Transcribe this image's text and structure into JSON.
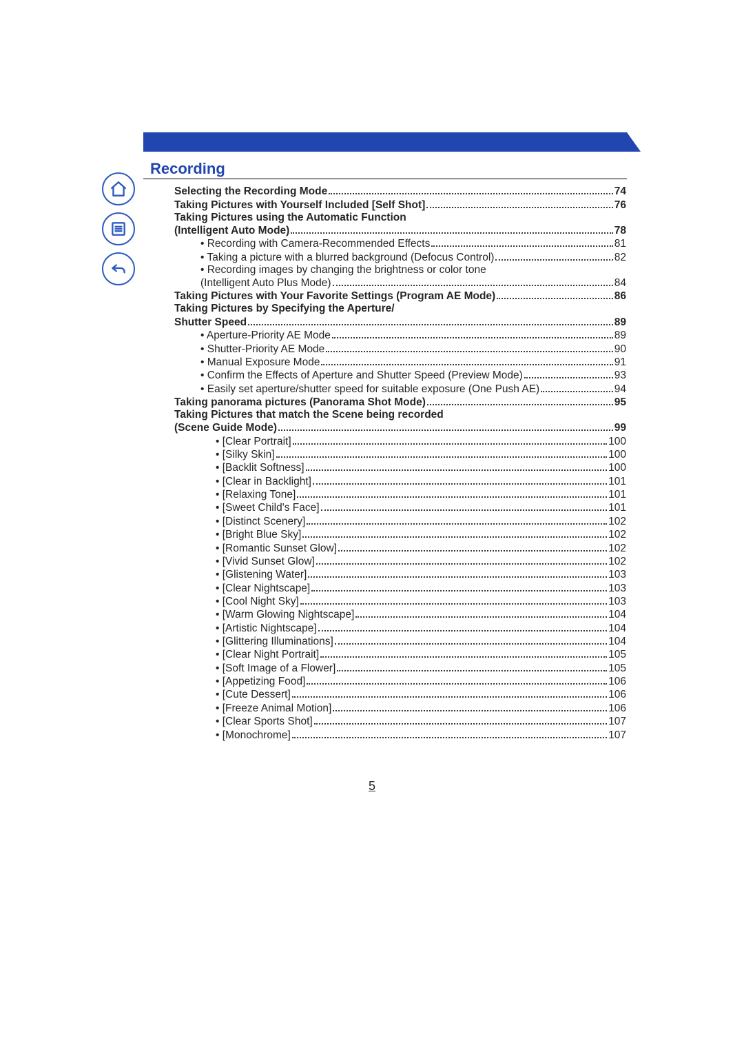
{
  "pageNumber": "5",
  "sectionTitle": "Recording",
  "sidebar": {
    "home": "home-icon",
    "toc": "toc-icon",
    "back": "back-icon"
  },
  "entries": [
    {
      "level": 1,
      "bold": true,
      "bullet": false,
      "text": "Selecting the Recording Mode",
      "page": "74"
    },
    {
      "level": 1,
      "bold": true,
      "bullet": false,
      "text": "Taking Pictures with Yourself Included [Self Shot]",
      "page": "76"
    },
    {
      "level": 1,
      "bold": true,
      "bullet": false,
      "text": "Taking Pictures using the Automatic Function",
      "page": "",
      "noLeader": true
    },
    {
      "level": 1,
      "bold": true,
      "bullet": false,
      "text": "(Intelligent Auto Mode)",
      "page": "78"
    },
    {
      "level": 2,
      "bold": false,
      "bullet": true,
      "text": "Recording with Camera-Recommended Effects",
      "page": "81"
    },
    {
      "level": 2,
      "bold": false,
      "bullet": true,
      "text": "Taking a picture with a blurred background (Defocus Control)",
      "page": "82"
    },
    {
      "level": 2,
      "bold": false,
      "bullet": true,
      "text": "Recording images by changing the brightness or color tone",
      "page": "",
      "noLeader": true
    },
    {
      "level": 2,
      "bold": false,
      "bullet": false,
      "text": "(Intelligent Auto Plus Mode)",
      "page": "84"
    },
    {
      "level": 1,
      "bold": true,
      "bullet": false,
      "text": "Taking Pictures with Your Favorite Settings (Program AE Mode)",
      "page": "86"
    },
    {
      "level": 1,
      "bold": true,
      "bullet": false,
      "text": "Taking Pictures by Specifying the Aperture/",
      "page": "",
      "noLeader": true
    },
    {
      "level": 1,
      "bold": true,
      "bullet": false,
      "text": "Shutter Speed",
      "page": "89"
    },
    {
      "level": 2,
      "bold": false,
      "bullet": true,
      "text": "Aperture-Priority AE Mode",
      "page": "89"
    },
    {
      "level": 2,
      "bold": false,
      "bullet": true,
      "text": "Shutter-Priority AE Mode",
      "page": "90"
    },
    {
      "level": 2,
      "bold": false,
      "bullet": true,
      "text": "Manual Exposure Mode",
      "page": "91"
    },
    {
      "level": 2,
      "bold": false,
      "bullet": true,
      "text": "Confirm the Effects of Aperture and Shutter Speed (Preview Mode)",
      "page": "93"
    },
    {
      "level": 2,
      "bold": false,
      "bullet": true,
      "text": "Easily set aperture/shutter speed for suitable exposure (One Push AE)",
      "page": "94"
    },
    {
      "level": 1,
      "bold": true,
      "bullet": false,
      "text": "Taking panorama pictures (Panorama Shot Mode)",
      "page": "95"
    },
    {
      "level": 1,
      "bold": true,
      "bullet": false,
      "text": "Taking Pictures that match the Scene being recorded",
      "page": "",
      "noLeader": true
    },
    {
      "level": 1,
      "bold": true,
      "bullet": false,
      "text": "(Scene Guide Mode)",
      "page": "99"
    },
    {
      "level": 3,
      "bold": false,
      "bullet": true,
      "text": "[Clear Portrait]",
      "page": "100"
    },
    {
      "level": 3,
      "bold": false,
      "bullet": true,
      "text": "[Silky Skin]",
      "page": "100"
    },
    {
      "level": 3,
      "bold": false,
      "bullet": true,
      "text": "[Backlit Softness]",
      "page": "100"
    },
    {
      "level": 3,
      "bold": false,
      "bullet": true,
      "text": "[Clear in Backlight]",
      "page": "101"
    },
    {
      "level": 3,
      "bold": false,
      "bullet": true,
      "text": "[Relaxing Tone]",
      "page": "101"
    },
    {
      "level": 3,
      "bold": false,
      "bullet": true,
      "text": "[Sweet Child's Face]",
      "page": "101"
    },
    {
      "level": 3,
      "bold": false,
      "bullet": true,
      "text": "[Distinct Scenery]",
      "page": "102"
    },
    {
      "level": 3,
      "bold": false,
      "bullet": true,
      "text": "[Bright Blue Sky]",
      "page": "102"
    },
    {
      "level": 3,
      "bold": false,
      "bullet": true,
      "text": "[Romantic Sunset Glow]",
      "page": "102"
    },
    {
      "level": 3,
      "bold": false,
      "bullet": true,
      "text": "[Vivid Sunset Glow]",
      "page": "102"
    },
    {
      "level": 3,
      "bold": false,
      "bullet": true,
      "text": "[Glistening Water]",
      "page": "103"
    },
    {
      "level": 3,
      "bold": false,
      "bullet": true,
      "text": "[Clear Nightscape]",
      "page": "103"
    },
    {
      "level": 3,
      "bold": false,
      "bullet": true,
      "text": "[Cool Night Sky]",
      "page": "103"
    },
    {
      "level": 3,
      "bold": false,
      "bullet": true,
      "text": "[Warm Glowing Nightscape]",
      "page": "104"
    },
    {
      "level": 3,
      "bold": false,
      "bullet": true,
      "text": "[Artistic Nightscape]",
      "page": "104"
    },
    {
      "level": 3,
      "bold": false,
      "bullet": true,
      "text": "[Glittering Illuminations]",
      "page": "104"
    },
    {
      "level": 3,
      "bold": false,
      "bullet": true,
      "text": "[Clear Night Portrait]",
      "page": "105"
    },
    {
      "level": 3,
      "bold": false,
      "bullet": true,
      "text": "[Soft Image of a Flower]",
      "page": "105"
    },
    {
      "level": 3,
      "bold": false,
      "bullet": true,
      "text": "[Appetizing Food]",
      "page": "106"
    },
    {
      "level": 3,
      "bold": false,
      "bullet": true,
      "text": "[Cute Dessert]",
      "page": "106"
    },
    {
      "level": 3,
      "bold": false,
      "bullet": true,
      "text": "[Freeze Animal Motion]",
      "page": "106"
    },
    {
      "level": 3,
      "bold": false,
      "bullet": true,
      "text": "[Clear Sports Shot]",
      "page": "107"
    },
    {
      "level": 3,
      "bold": false,
      "bullet": true,
      "text": "[Monochrome]",
      "page": "107"
    }
  ]
}
